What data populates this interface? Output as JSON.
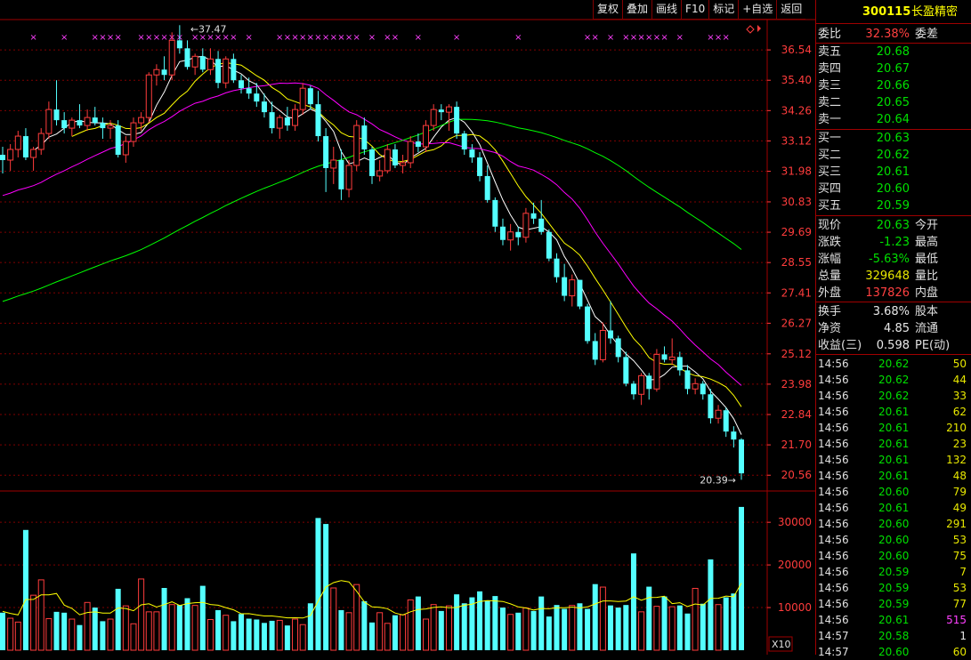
{
  "toolbar": [
    "复权",
    "叠加",
    "画线",
    "F10",
    "标记",
    "+自选",
    "返回"
  ],
  "stock": {
    "code": "300115",
    "name": "长盈精密"
  },
  "colors": {
    "up": "#ff3c3c",
    "down": "#54ffff",
    "ma5": "#ffffff",
    "ma10": "#ffff00",
    "ma20": "#ff00ff",
    "ma60": "#00ff00",
    "grid": "#800000",
    "axis": "#ff3c3c",
    "volma": "#ffff00"
  },
  "chart_data": {
    "type": "candlestick",
    "title": "",
    "price_axis_ticks": [
      "36.54",
      "35.40",
      "34.26",
      "33.12",
      "31.98",
      "30.83",
      "29.69",
      "28.55",
      "27.41",
      "26.27",
      "25.12",
      "23.98",
      "22.84",
      "21.70",
      "20.56"
    ],
    "volume_axis_ticks": [
      "30000",
      "20000",
      "10000"
    ],
    "volume_unit_label": "X10",
    "high_annotation": "37.47",
    "low_annotation": "20.39",
    "candles": [
      [
        32.6,
        32.9,
        31.9,
        32.4
      ],
      [
        32.4,
        33.0,
        32.0,
        32.8
      ],
      [
        32.8,
        33.5,
        32.5,
        33.3
      ],
      [
        33.3,
        33.6,
        32.4,
        32.5
      ],
      [
        32.5,
        32.9,
        32.0,
        32.8
      ],
      [
        32.8,
        33.6,
        32.6,
        33.4
      ],
      [
        33.4,
        34.6,
        33.2,
        34.3
      ],
      [
        34.3,
        35.4,
        33.7,
        33.9
      ],
      [
        33.9,
        34.2,
        33.4,
        33.6
      ],
      [
        33.6,
        34.0,
        33.3,
        33.9
      ],
      [
        33.9,
        34.5,
        33.6,
        33.7
      ],
      [
        33.7,
        34.3,
        33.5,
        34.0
      ],
      [
        34.0,
        34.4,
        33.7,
        33.8
      ],
      [
        33.8,
        34.0,
        33.2,
        33.6
      ],
      [
        33.6,
        33.9,
        33.2,
        33.7
      ],
      [
        33.7,
        33.9,
        32.5,
        32.6
      ],
      [
        32.6,
        33.3,
        32.3,
        33.1
      ],
      [
        33.1,
        34.0,
        32.9,
        33.8
      ],
      [
        33.8,
        34.2,
        33.5,
        34.0
      ],
      [
        34.0,
        35.7,
        33.8,
        35.6
      ],
      [
        35.6,
        36.0,
        35.2,
        35.8
      ],
      [
        35.8,
        36.3,
        35.4,
        35.6
      ],
      [
        35.6,
        37.2,
        35.4,
        36.9
      ],
      [
        36.9,
        37.47,
        36.4,
        36.6
      ],
      [
        36.6,
        36.9,
        35.8,
        35.9
      ],
      [
        35.9,
        36.4,
        35.6,
        36.3
      ],
      [
        36.3,
        36.6,
        35.7,
        35.8
      ],
      [
        35.8,
        36.6,
        35.6,
        36.2
      ],
      [
        36.2,
        36.5,
        35.1,
        35.3
      ],
      [
        35.3,
        36.3,
        35.1,
        36.2
      ],
      [
        36.2,
        36.4,
        35.3,
        35.4
      ],
      [
        35.4,
        35.6,
        34.9,
        35.1
      ],
      [
        35.1,
        35.5,
        34.7,
        34.9
      ],
      [
        34.9,
        35.3,
        34.4,
        34.6
      ],
      [
        34.6,
        34.9,
        34.0,
        34.2
      ],
      [
        34.2,
        34.6,
        33.4,
        33.6
      ],
      [
        33.6,
        34.1,
        33.2,
        34.0
      ],
      [
        34.0,
        34.4,
        33.5,
        33.7
      ],
      [
        33.7,
        34.5,
        33.5,
        34.3
      ],
      [
        34.3,
        35.3,
        34.1,
        35.1
      ],
      [
        35.1,
        35.2,
        34.3,
        34.5
      ],
      [
        34.5,
        35.0,
        33.1,
        33.3
      ],
      [
        33.3,
        33.6,
        31.2,
        32.1
      ],
      [
        32.1,
        32.9,
        31.5,
        32.4
      ],
      [
        32.4,
        32.8,
        30.9,
        31.3
      ],
      [
        31.3,
        32.4,
        31.0,
        32.2
      ],
      [
        32.2,
        33.9,
        32.0,
        33.7
      ],
      [
        33.7,
        34.0,
        32.6,
        32.8
      ],
      [
        32.8,
        32.9,
        31.5,
        31.8
      ],
      [
        31.8,
        32.4,
        31.6,
        32.0
      ],
      [
        32.0,
        33.0,
        31.9,
        32.8
      ],
      [
        32.8,
        33.0,
        32.1,
        32.2
      ],
      [
        32.2,
        32.6,
        31.9,
        32.3
      ],
      [
        32.3,
        33.3,
        32.1,
        33.1
      ],
      [
        33.1,
        33.4,
        32.7,
        32.9
      ],
      [
        32.9,
        33.9,
        32.7,
        33.7
      ],
      [
        33.7,
        34.5,
        33.5,
        34.3
      ],
      [
        34.3,
        34.5,
        33.9,
        34.2
      ],
      [
        34.2,
        34.5,
        33.5,
        34.4
      ],
      [
        34.4,
        34.6,
        33.2,
        33.4
      ],
      [
        33.4,
        33.5,
        32.6,
        32.8
      ],
      [
        32.8,
        33.0,
        32.3,
        32.5
      ],
      [
        32.5,
        32.7,
        31.6,
        31.8
      ],
      [
        31.8,
        32.2,
        30.8,
        30.9
      ],
      [
        30.9,
        31.0,
        29.7,
        29.9
      ],
      [
        29.9,
        30.2,
        29.2,
        29.4
      ],
      [
        29.4,
        30.0,
        29.0,
        29.7
      ],
      [
        29.7,
        29.9,
        29.2,
        29.5
      ],
      [
        29.5,
        30.6,
        29.3,
        30.4
      ],
      [
        30.4,
        30.8,
        30.0,
        30.2
      ],
      [
        30.2,
        30.9,
        29.6,
        29.7
      ],
      [
        29.7,
        29.8,
        28.6,
        28.7
      ],
      [
        28.7,
        28.9,
        27.8,
        28.0
      ],
      [
        28.0,
        28.5,
        27.1,
        27.3
      ],
      [
        27.3,
        28.1,
        26.9,
        27.9
      ],
      [
        27.9,
        27.9,
        26.8,
        26.9
      ],
      [
        26.9,
        27.0,
        25.5,
        25.6
      ],
      [
        25.6,
        25.9,
        24.7,
        24.9
      ],
      [
        24.9,
        26.3,
        24.8,
        26.0
      ],
      [
        26.0,
        27.1,
        25.5,
        25.7
      ],
      [
        25.7,
        25.8,
        24.8,
        25.0
      ],
      [
        25.0,
        25.2,
        23.9,
        24.0
      ],
      [
        24.0,
        24.1,
        23.4,
        23.6
      ],
      [
        23.6,
        24.4,
        23.2,
        24.3
      ],
      [
        24.3,
        24.4,
        23.4,
        23.8
      ],
      [
        23.8,
        25.3,
        23.7,
        25.1
      ],
      [
        25.1,
        25.4,
        24.8,
        24.9
      ],
      [
        24.9,
        25.7,
        24.7,
        25.0
      ],
      [
        25.0,
        25.2,
        24.3,
        24.5
      ],
      [
        24.5,
        24.7,
        23.6,
        23.8
      ],
      [
        23.8,
        24.2,
        23.6,
        24.0
      ],
      [
        24.0,
        24.1,
        23.4,
        23.6
      ],
      [
        23.6,
        23.8,
        22.5,
        22.7
      ],
      [
        22.7,
        23.2,
        22.5,
        23.0
      ],
      [
        23.0,
        23.1,
        22.0,
        22.2
      ],
      [
        22.2,
        22.4,
        21.6,
        21.9
      ],
      [
        21.9,
        21.95,
        20.39,
        20.63
      ]
    ],
    "volumes": [
      8800,
      7500,
      6600,
      28200,
      12900,
      16500,
      7400,
      9000,
      8800,
      7300,
      5900,
      11200,
      10000,
      6800,
      7300,
      14400,
      10400,
      6200,
      16700,
      9000,
      9000,
      14600,
      10700,
      10600,
      12200,
      10500,
      15100,
      7200,
      9400,
      8200,
      6800,
      8500,
      7400,
      7200,
      6400,
      6900,
      7000,
      5800,
      7300,
      6000,
      11000,
      31000,
      29600,
      14600,
      9400,
      8800,
      15400,
      11500,
      6500,
      8800,
      6300,
      8200,
      8300,
      11800,
      12600,
      7300,
      10700,
      9200,
      10400,
      13100,
      11000,
      12400,
      13800,
      11700,
      12700,
      10000,
      8400,
      8800,
      9900,
      9200,
      12600,
      7900,
      10600,
      9700,
      10500,
      11000,
      9700,
      15500,
      14800,
      10500,
      10000,
      10600,
      22700,
      9000,
      14900,
      10300,
      12600,
      10200,
      10500,
      8600,
      14500,
      10900,
      21300,
      10700,
      12400,
      13300,
      33600
    ]
  },
  "panel": {
    "committee": [
      {
        "label": "委比",
        "value": "32.38%",
        "cls": "red",
        "label2": "委差"
      }
    ],
    "asks": [
      {
        "label": "卖五",
        "value": "20.68"
      },
      {
        "label": "卖四",
        "value": "20.67"
      },
      {
        "label": "卖三",
        "value": "20.66"
      },
      {
        "label": "卖二",
        "value": "20.65"
      },
      {
        "label": "卖一",
        "value": "20.64"
      }
    ],
    "bids": [
      {
        "label": "买一",
        "value": "20.63"
      },
      {
        "label": "买二",
        "value": "20.62"
      },
      {
        "label": "买三",
        "value": "20.61"
      },
      {
        "label": "买四",
        "value": "20.60"
      },
      {
        "label": "买五",
        "value": "20.59"
      }
    ],
    "quote": [
      {
        "label": "现价",
        "value": "20.63",
        "cls": "green",
        "label2": "今开"
      },
      {
        "label": "涨跌",
        "value": "-1.23",
        "cls": "green",
        "label2": "最高"
      },
      {
        "label": "涨幅",
        "value": "-5.63%",
        "cls": "green",
        "label2": "最低"
      },
      {
        "label": "总量",
        "value": "329648",
        "cls": "yellow",
        "label2": "量比"
      },
      {
        "label": "外盘",
        "value": "137826",
        "cls": "red",
        "label2": "内盘"
      }
    ],
    "stats": [
      {
        "label": "换手",
        "value": "3.68%",
        "cls": "white",
        "label2": "股本"
      },
      {
        "label": "净资",
        "value": "4.85",
        "cls": "white",
        "label2": "流通"
      },
      {
        "label": "收益(三)",
        "value": "0.598",
        "cls": "white",
        "label2": "PE(动)"
      }
    ],
    "ticks": [
      {
        "time": "14:56",
        "price": "20.62",
        "vol": "50",
        "vc": "yellow"
      },
      {
        "time": "14:56",
        "price": "20.62",
        "vol": "44",
        "vc": "yellow"
      },
      {
        "time": "14:56",
        "price": "20.62",
        "vol": "33",
        "vc": "yellow"
      },
      {
        "time": "14:56",
        "price": "20.61",
        "vol": "62",
        "vc": "yellow"
      },
      {
        "time": "14:56",
        "price": "20.61",
        "vol": "210",
        "vc": "yellow"
      },
      {
        "time": "14:56",
        "price": "20.61",
        "vol": "23",
        "vc": "yellow"
      },
      {
        "time": "14:56",
        "price": "20.61",
        "vol": "132",
        "vc": "yellow"
      },
      {
        "time": "14:56",
        "price": "20.61",
        "vol": "48",
        "vc": "yellow"
      },
      {
        "time": "14:56",
        "price": "20.60",
        "vol": "79",
        "vc": "yellow"
      },
      {
        "time": "14:56",
        "price": "20.61",
        "vol": "49",
        "vc": "yellow"
      },
      {
        "time": "14:56",
        "price": "20.60",
        "vol": "291",
        "vc": "yellow"
      },
      {
        "time": "14:56",
        "price": "20.60",
        "vol": "53",
        "vc": "yellow"
      },
      {
        "time": "14:56",
        "price": "20.60",
        "vol": "75",
        "vc": "yellow"
      },
      {
        "time": "14:56",
        "price": "20.59",
        "vol": "7",
        "vc": "yellow"
      },
      {
        "time": "14:56",
        "price": "20.59",
        "vol": "53",
        "vc": "yellow"
      },
      {
        "time": "14:56",
        "price": "20.59",
        "vol": "77",
        "vc": "yellow"
      },
      {
        "time": "14:56",
        "price": "20.61",
        "vol": "515",
        "vc": "magenta"
      },
      {
        "time": "14:57",
        "price": "20.58",
        "vol": "1",
        "vc": "white"
      },
      {
        "time": "14:57",
        "price": "20.60",
        "vol": "60",
        "vc": "yellow"
      }
    ]
  }
}
